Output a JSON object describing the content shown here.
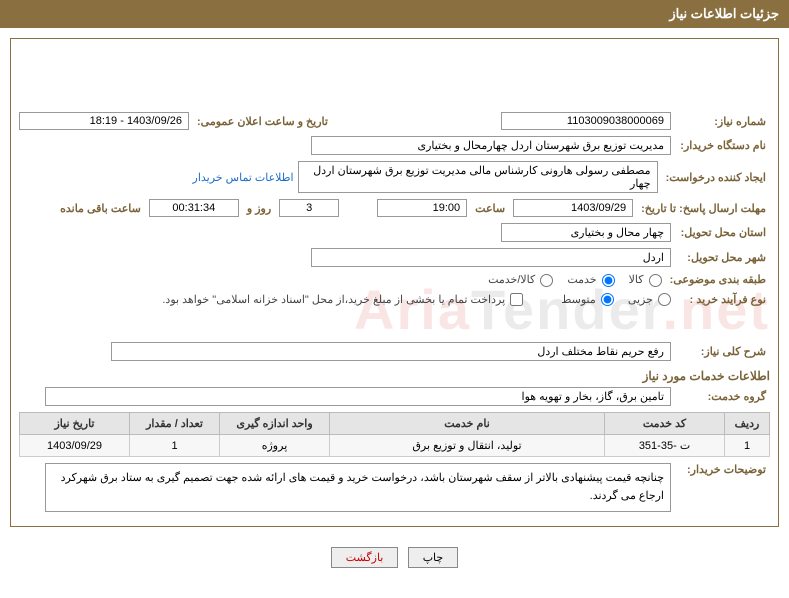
{
  "header": {
    "title": "جزئیات اطلاعات نیاز"
  },
  "need_no": {
    "label": "شماره نیاز:",
    "value": "1103009038000069"
  },
  "announce": {
    "label": "تاریخ و ساعت اعلان عمومی:",
    "value": "1403/09/26 - 18:19"
  },
  "buyer_org": {
    "label": "نام دستگاه خریدار:",
    "value": "مدیریت توزیع برق شهرستان اردل چهارمحال و بختیاری"
  },
  "requester": {
    "label": "ایجاد کننده درخواست:",
    "value": "مصطفی رسولی هارونی کارشناس مالی مدیریت توزیع برق شهرستان اردل چهار",
    "link": "اطلاعات تماس خریدار"
  },
  "deadline": {
    "label": "مهلت ارسال پاسخ: تا تاریخ:",
    "date": "1403/09/29",
    "time_label": "ساعت",
    "time": "19:00",
    "days": "3",
    "days_label": "روز و",
    "remaining": "00:31:34",
    "remaining_label": "ساعت باقی مانده"
  },
  "province": {
    "label": "استان محل تحویل:",
    "value": "چهار محال و بختیاری"
  },
  "city": {
    "label": "شهر محل تحویل:",
    "value": "اردل"
  },
  "category": {
    "label": "طبقه بندی موضوعی:",
    "opts": [
      "کالا",
      "خدمت",
      "کالا/خدمت"
    ]
  },
  "process": {
    "label": "نوع فرآیند خرید :",
    "opts": [
      "جزیی",
      "متوسط"
    ],
    "check": "پرداخت تمام یا بخشی از مبلغ خرید،از محل \"اسناد خزانه اسلامی\" خواهد بود."
  },
  "need_desc": {
    "label": "شرح کلی نیاز:",
    "value": "رفع حریم نقاط مختلف اردل"
  },
  "svc_section": {
    "title": "اطلاعات خدمات مورد نیاز"
  },
  "group": {
    "label": "گروه خدمت:",
    "value": "تامین برق، گاز، بخار و تهویه هوا"
  },
  "table": {
    "headers": [
      "ردیف",
      "کد خدمت",
      "نام خدمت",
      "واحد اندازه گیری",
      "تعداد / مقدار",
      "تاریخ نیاز"
    ],
    "row": [
      "1",
      "ت -35-351",
      "تولید، انتقال و توزیع برق",
      "پروژه",
      "1",
      "1403/09/29"
    ]
  },
  "buyer_notes": {
    "label": "توضیحات خریدار:",
    "value": "چنانچه قیمت پیشنهادی بالاتر از سقف شهرستان باشد، درخواست خرید و قیمت های ارائه شده جهت تصمیم گیری به ستاد برق شهرکرد ارجاع می گردند."
  },
  "buttons": {
    "print": "چاپ",
    "back": "بازگشت"
  },
  "watermark": {
    "a": "Aria",
    "b": "Tender",
    "c": ".net"
  }
}
